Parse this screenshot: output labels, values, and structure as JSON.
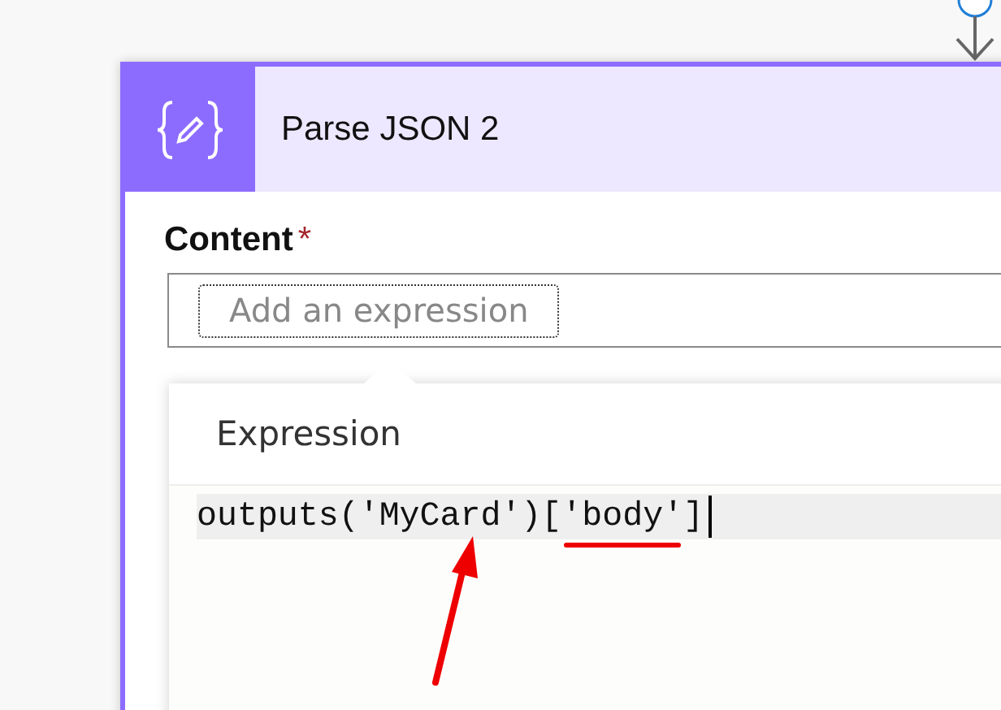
{
  "card": {
    "title": "Parse JSON 2",
    "field": {
      "label": "Content",
      "required_mark": "*",
      "placeholder": "Add an expression"
    }
  },
  "expression_popup": {
    "title": "Expression",
    "value": "outputs('MyCard')['body']"
  }
}
